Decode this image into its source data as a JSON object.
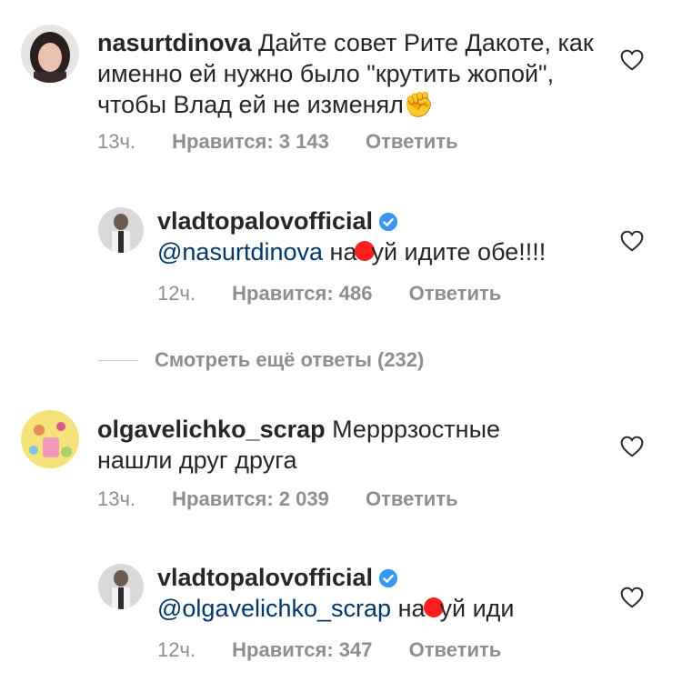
{
  "comments": [
    {
      "username": "nasurtdinova",
      "text": "Дайте совет Рите Дакоте, как именно ей нужно было \"крутить жопой\", чтобы Влад ей не изменял",
      "emoji": "✊",
      "time": "13ч.",
      "likes": "Нравится: 3 143",
      "reply": "Ответить"
    },
    {
      "username": "vladtopalovofficial",
      "mention": "@nasurtdinova",
      "text_before": "на",
      "text_after": "уй идите обе!!!!",
      "time": "12ч.",
      "likes": "Нравится: 486",
      "reply": "Ответить"
    },
    {
      "username": "olgavelichko_scrap",
      "text": "Мерррзостные нашли друг друга",
      "time": "13ч.",
      "likes": "Нравится: 2 039",
      "reply": "Ответить"
    },
    {
      "username": "vladtopalovofficial",
      "mention": "@olgavelichko_scrap",
      "text_before": "на",
      "text_after": "уй иди",
      "time": "12ч.",
      "likes": "Нравится: 347",
      "reply": "Ответить"
    }
  ],
  "view_more": "Смотреть ещё ответы (232)",
  "colors": {
    "text": "#262626",
    "meta": "#8e8e8e",
    "mention": "#00376b",
    "verified": "#3897f0",
    "redaction": "#ff1d1d"
  }
}
